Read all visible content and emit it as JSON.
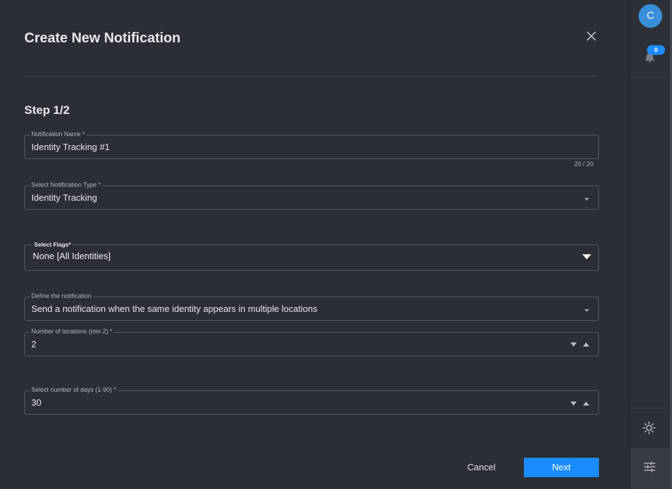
{
  "dialog": {
    "title": "Create New Notification",
    "close_icon": "close-icon",
    "step": "Step 1/2",
    "fields": {
      "notification_name": {
        "label": "Notification Name *",
        "value": "Identity Tracking #1",
        "counter": "20 / 20"
      },
      "notification_type": {
        "label": "Select Notification Type *",
        "value": "Identity Tracking",
        "icon": "chevron-down-icon"
      },
      "flags": {
        "label": "Select Flags*",
        "value": "None [All Identities]",
        "icon": "caret-down-icon"
      },
      "definition": {
        "label": "Define the notification",
        "value": "Send a notification when the same identity appears in multiple locations",
        "icon": "chevron-down-icon"
      },
      "locations": {
        "label": "Number of locations (min 2) *",
        "value": 2,
        "icons": [
          "decrement-arrow-icon",
          "increment-arrow-icon"
        ]
      },
      "days": {
        "label": "Select number of days (1-90) *",
        "value": 30,
        "icons": [
          "decrement-arrow-icon",
          "increment-arrow-icon"
        ]
      }
    },
    "actions": {
      "cancel_label": "Cancel",
      "next_label": "Next"
    }
  },
  "sidebar": {
    "avatar_initial": "C",
    "notifications": {
      "icon": "bell-icon",
      "badge_count": 0
    },
    "theme_icon": "sun-icon",
    "settings_icon": "sliders-icon"
  },
  "colors": {
    "bg": "#2b2e35",
    "sidebar_bg": "#2d3037",
    "accent": "#1a8cff",
    "avatar": "#3a8fd9"
  }
}
